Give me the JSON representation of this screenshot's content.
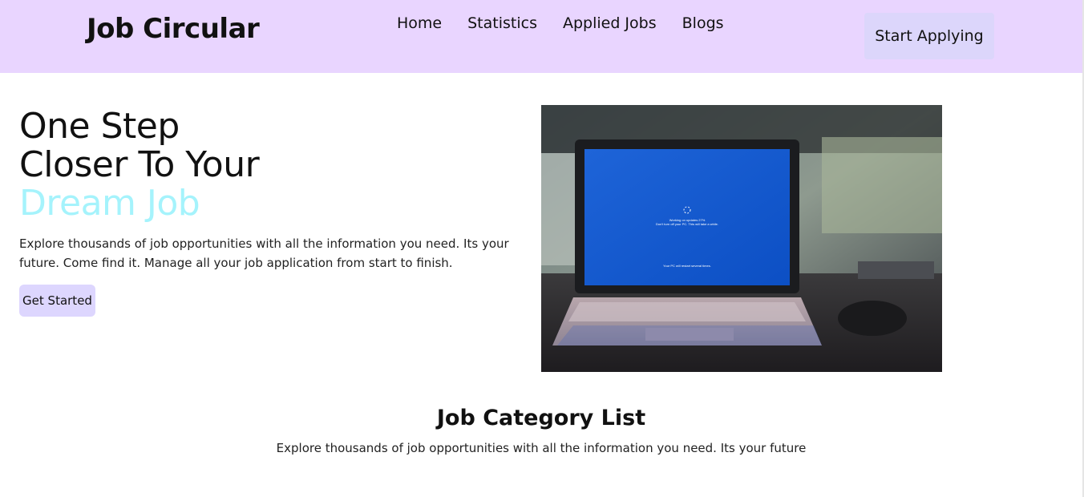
{
  "header": {
    "brand": "Job Circular",
    "nav": [
      "Home",
      "Statistics",
      "Applied Jobs",
      "Blogs"
    ],
    "cta_label": "Start Applying"
  },
  "hero": {
    "title_line1": "One Step",
    "title_line2": "Closer To Your",
    "title_accent": "Dream Job",
    "description": "Explore thousands of job opportunities with all the information you need. Its your future. Come find it. Manage all your job application from start to finish.",
    "button_label": "Get Started",
    "image": {
      "alt": "laptop-on-desk-photo",
      "screen_text_1": "Working on updates  27%",
      "screen_text_2": "Don't turn off your PC. This will take a while.",
      "screen_text_3": "Your PC will restart several times."
    }
  },
  "category_section": {
    "title": "Job Category List",
    "subtitle": "Explore thousands of job opportunities with all the information you need. Its your future"
  },
  "colors": {
    "navbar_bg": "#e9d5ff",
    "cta_bg": "#dcd6fb",
    "accent_text": "#a5f3fc",
    "button_bg": "#ddd6fe"
  }
}
